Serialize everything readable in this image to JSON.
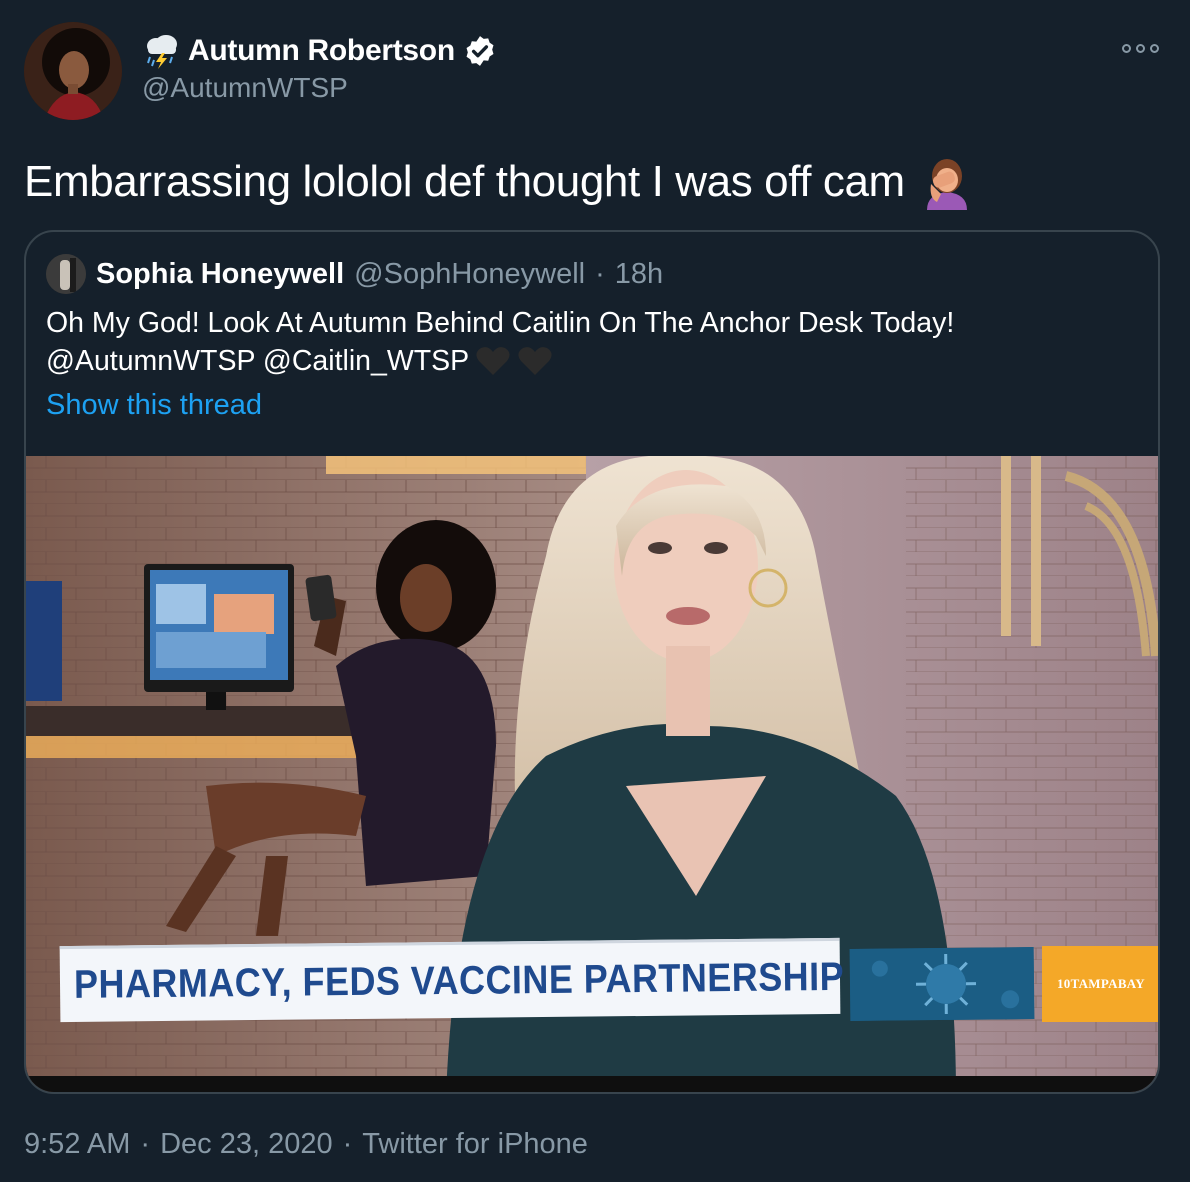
{
  "author": {
    "display_name": "Autumn Robertson",
    "handle": "@AutumnWTSP",
    "verified": true,
    "name_icon": "cloud-lightning-rain-icon"
  },
  "tweet": {
    "text": "Embarrassing lololol def thought I was off cam",
    "emoji": "person-facepalming-icon"
  },
  "quoted": {
    "display_name": "Sophia Honeywell",
    "handle": "@SophHoneywell",
    "separator": "·",
    "age": "18h",
    "line1": "Oh My God! Look At Autumn Behind Caitlin On The Anchor Desk Today!",
    "line2": "@AutumnWTSP @Caitlin_WTSP",
    "hearts": [
      "black-heart-icon",
      "black-heart-icon"
    ],
    "show_thread": "Show this thread",
    "media": {
      "chyron": "PHARMACY, FEDS VACCINE PARTNERSHIP",
      "station": "10TAMPABAY"
    }
  },
  "meta": {
    "time": "9:52 AM",
    "sep1": "·",
    "date": "Dec 23, 2020",
    "sep2": "·",
    "source": "Twitter for iPhone"
  },
  "colors": {
    "background": "#15202b",
    "secondary_text": "#8899a6",
    "link": "#1da1f2",
    "border": "#38444d"
  }
}
